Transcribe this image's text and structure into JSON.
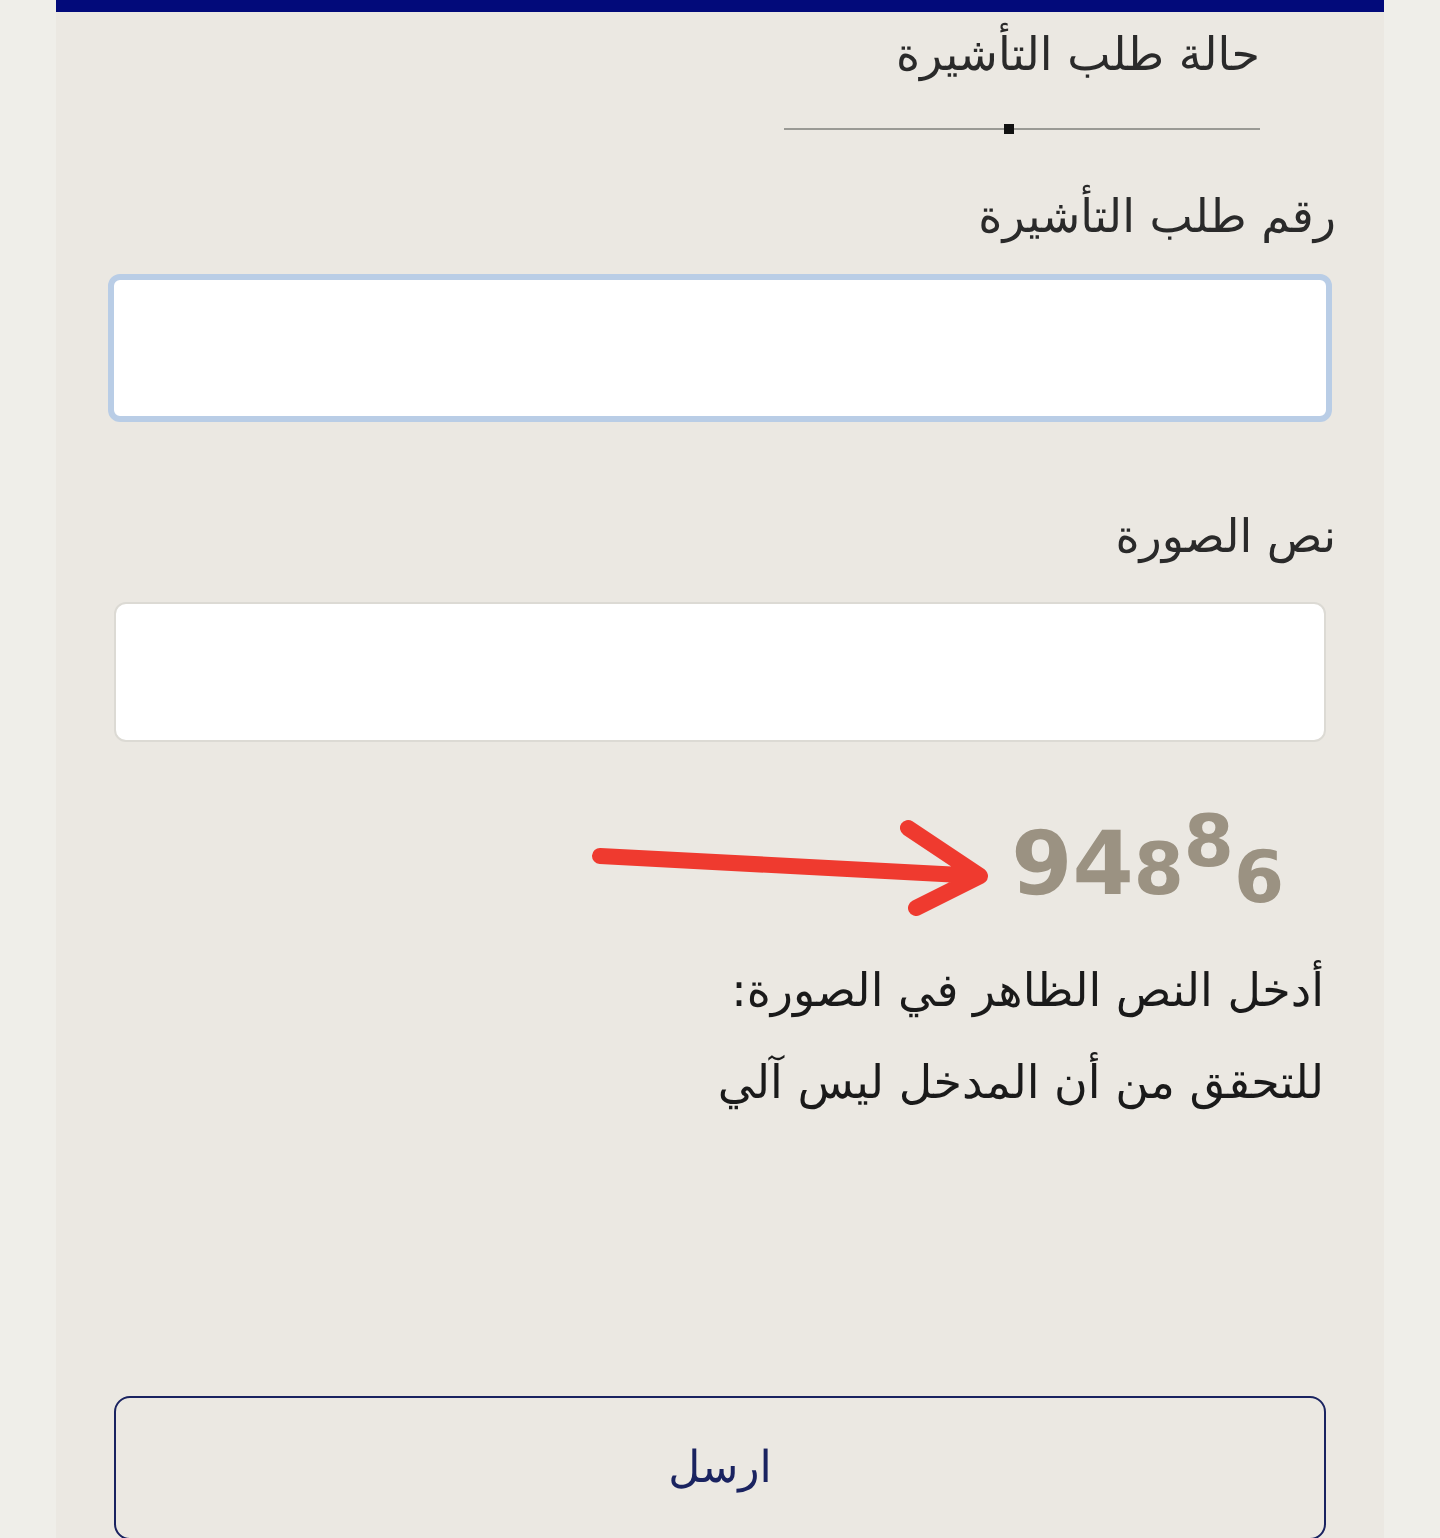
{
  "tab": {
    "label": "حالة طلب التأشيرة",
    "selected": true
  },
  "fields": [
    {
      "label": "رقم طلب التأشيرة",
      "focused": true
    },
    {
      "label": "نص الصورة",
      "focused": false
    }
  ],
  "captcha": "94886",
  "instructions": [
    "أدخل النص الظاهر في الصورة:",
    "للتحقق من أن المدخل ليس آلي"
  ],
  "submit": "ارسل"
}
